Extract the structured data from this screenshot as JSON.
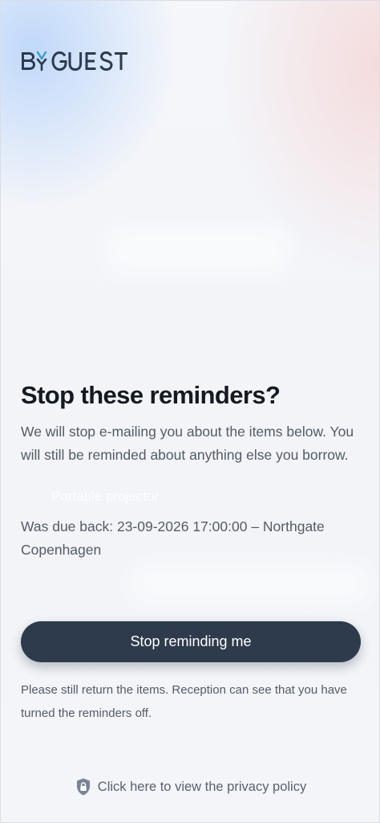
{
  "brand": {
    "logo_text": "BYMYGUEST"
  },
  "dialog": {
    "title": "Stop these reminders?",
    "description": "We will stop e-mailing you about the items below. You will still be reminded about anything else you borrow.",
    "item_name": "Portable projector",
    "due_text": "Was due back: 23-09-2026 17:00:00 – Northgate Copenhagen"
  },
  "actions": {
    "stop_button_label": "Stop reminding me"
  },
  "footer": {
    "note": "Please still return the items. Reception can see that you have turned the reminders off.",
    "privacy_link": "Click here to view the privacy policy"
  },
  "colors": {
    "button_bg": "#2e3b4c",
    "title_text": "#151a22",
    "body_text": "#545b66",
    "logo_blue": "#3a9ec8",
    "logo_dark": "#2b3a4d"
  }
}
